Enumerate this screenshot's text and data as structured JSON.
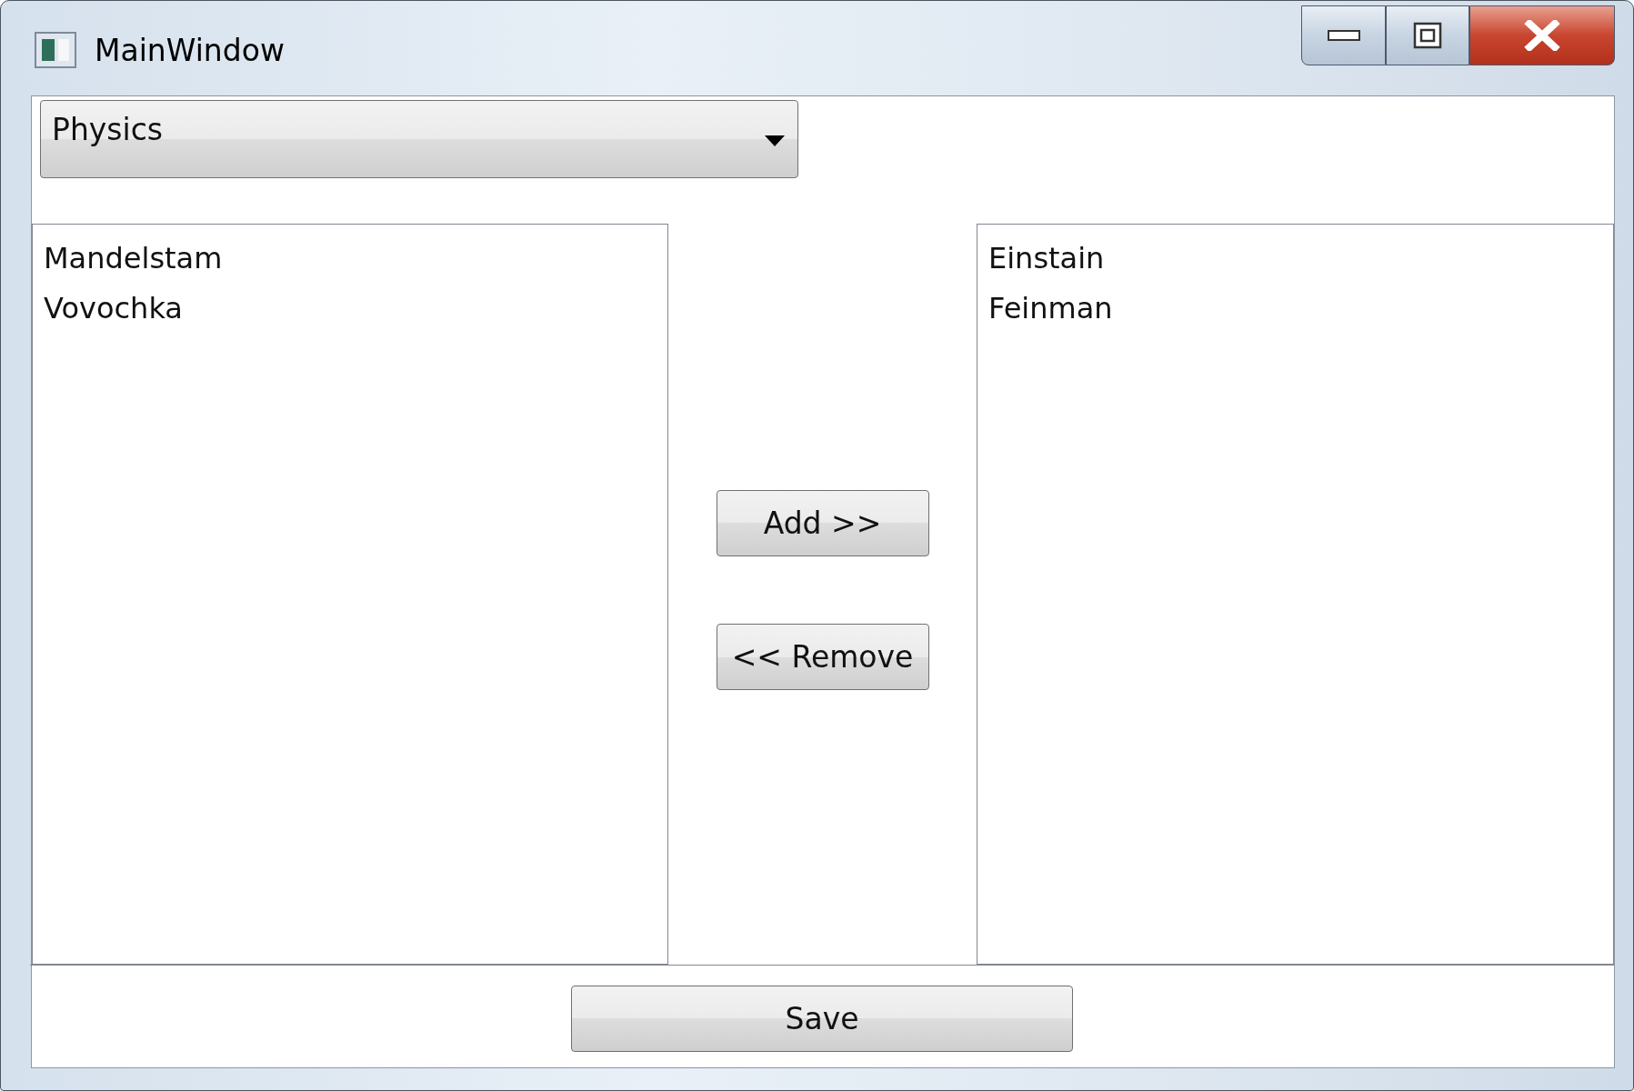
{
  "window": {
    "title": "MainWindow"
  },
  "subject_dropdown": {
    "value": "Physics"
  },
  "available_list": {
    "items": [
      {
        "label": "Mandelstam",
        "selected": false
      },
      {
        "label": "Vovochka",
        "selected": false
      }
    ]
  },
  "buttons": [
    {
      "label": "Add >>"
    },
    {
      "label": "<< Remove"
    }
  ],
  "chosen_list": {
    "items": [
      {
        "label": "Einstain",
        "selected": false
      },
      {
        "label": "Feinman",
        "selected": false
      }
    ]
  },
  "save_button": {
    "label": "Save"
  }
}
